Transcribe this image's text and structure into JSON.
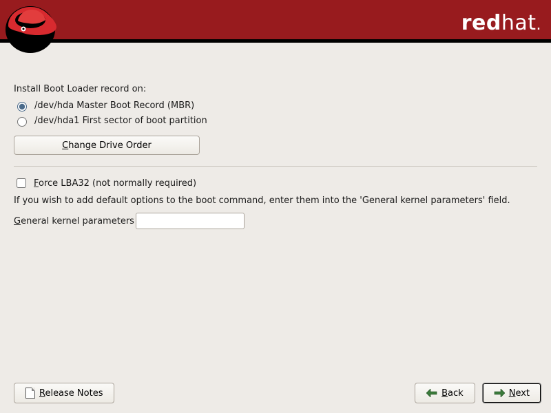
{
  "brand": {
    "strong": "red",
    "light": "hat",
    "dot": "."
  },
  "section": {
    "label": "Install Boot Loader record on:",
    "options": [
      {
        "label": "/dev/hda Master Boot Record (MBR)",
        "selected": true
      },
      {
        "label": "/dev/hda1 First sector of boot partition",
        "selected": false
      }
    ],
    "change_order_pre": "C",
    "change_order_post": "hange Drive Order"
  },
  "advanced": {
    "force_pre": "F",
    "force_post": "orce LBA32 (not normally required)",
    "hint": "If you wish to add default options to the boot command, enter them into the 'General kernel parameters' field.",
    "param_pre": "G",
    "param_post": "eneral kernel parameters",
    "param_value": ""
  },
  "footer": {
    "release_pre": "R",
    "release_post": "elease Notes",
    "back_pre": "B",
    "back_post": "ack",
    "next_pre": "N",
    "next_post": "ext"
  }
}
